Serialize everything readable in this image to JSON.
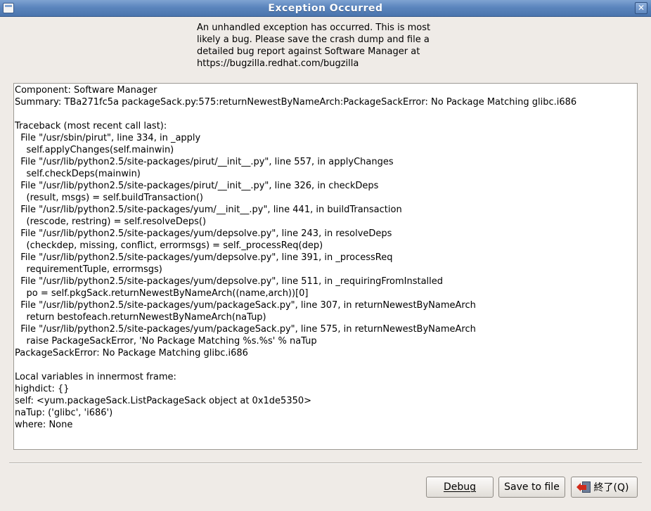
{
  "window": {
    "title": "Exception Occurred",
    "close_glyph": "✕"
  },
  "message": "An unhandled exception has occurred.  This is most\nlikely a bug.  Please save the crash dump and file a\ndetailed bug report against Software Manager at\nhttps://bugzilla.redhat.com/bugzilla",
  "crash_dump_lines": [
    "Component: Software Manager",
    "Summary: TBa271fc5a packageSack.py:575:returnNewestByNameArch:PackageSackError: No Package Matching glibc.i686",
    "",
    "Traceback (most recent call last):",
    "  File \"/usr/sbin/pirut\", line 334, in _apply",
    "    self.applyChanges(self.mainwin)",
    "  File \"/usr/lib/python2.5/site-packages/pirut/__init__.py\", line 557, in applyChanges",
    "    self.checkDeps(mainwin)",
    "  File \"/usr/lib/python2.5/site-packages/pirut/__init__.py\", line 326, in checkDeps",
    "    (result, msgs) = self.buildTransaction()",
    "  File \"/usr/lib/python2.5/site-packages/yum/__init__.py\", line 441, in buildTransaction",
    "    (rescode, restring) = self.resolveDeps()",
    "  File \"/usr/lib/python2.5/site-packages/yum/depsolve.py\", line 243, in resolveDeps",
    "    (checkdep, missing, conflict, errormsgs) = self._processReq(dep)",
    "  File \"/usr/lib/python2.5/site-packages/yum/depsolve.py\", line 391, in _processReq",
    "    requirementTuple, errormsgs)",
    "  File \"/usr/lib/python2.5/site-packages/yum/depsolve.py\", line 511, in _requiringFromInstalled",
    "    po = self.pkgSack.returnNewestByNameArch((name,arch))[0]",
    "  File \"/usr/lib/python2.5/site-packages/yum/packageSack.py\", line 307, in returnNewestByNameArch",
    "    return bestofeach.returnNewestByNameArch(naTup)",
    "  File \"/usr/lib/python2.5/site-packages/yum/packageSack.py\", line 575, in returnNewestByNameArch",
    "    raise PackageSackError, 'No Package Matching %s.%s' % naTup",
    "PackageSackError: No Package Matching glibc.i686",
    "",
    "Local variables in innermost frame:",
    "highdict: {}",
    "self: <yum.packageSack.ListPackageSack object at 0x1de5350>",
    "naTup: ('glibc', 'i686')",
    "where: None"
  ],
  "buttons": {
    "debug": "Debug",
    "save": "Save to file",
    "quit": "終了(Q)"
  },
  "icons": {
    "window": "window-menu-icon",
    "close": "close-icon",
    "quit": "quit-door-icon"
  },
  "colors": {
    "titlebar": "#5b85bd",
    "dialog_bg": "#efebe7",
    "quit_arrow": "#d12a1a"
  }
}
